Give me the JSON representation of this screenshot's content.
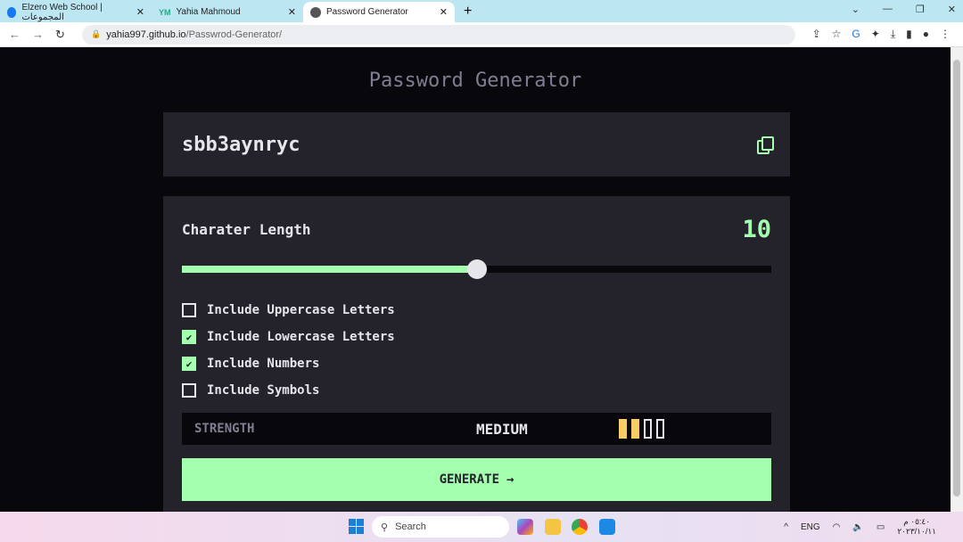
{
  "browser": {
    "tabs": [
      {
        "title": "Elzero Web School | المجموعات",
        "icon": "facebook-icon",
        "active": false
      },
      {
        "title": "Yahia Mahmoud",
        "icon": "ym-logo-icon",
        "active": false
      },
      {
        "title": "Password Generator",
        "icon": "globe-icon",
        "active": true
      }
    ],
    "new_tab": "+",
    "url_host": "yahia997.github.io",
    "url_path": "/Passwrod-Generator/"
  },
  "app": {
    "title": "Password Generator",
    "password": "sbb3aynryc",
    "length_label": "Charater Length",
    "length_value": "10",
    "length_min": 0,
    "length_max": 20,
    "length_current": 10,
    "options": [
      {
        "label": "Include Uppercase Letters",
        "checked": false
      },
      {
        "label": "Include Lowercase Letters",
        "checked": true
      },
      {
        "label": "Include Numbers",
        "checked": true
      },
      {
        "label": "Include Symbols",
        "checked": false
      }
    ],
    "strength_label": "STRENGTH",
    "strength_value": "MEDIUM",
    "strength_level": 2,
    "strength_max": 4,
    "generate_label": "GENERATE",
    "generate_arrow": "→",
    "colors": {
      "accent": "#a4ffaf",
      "strength": "#f8cd65",
      "panel": "#24232c",
      "background": "#08070b"
    }
  },
  "taskbar": {
    "search_placeholder": "Search",
    "lang": "ENG",
    "time": "٠٥:٤٠ م",
    "date": "٢٠٢٣/١٠/١١"
  }
}
